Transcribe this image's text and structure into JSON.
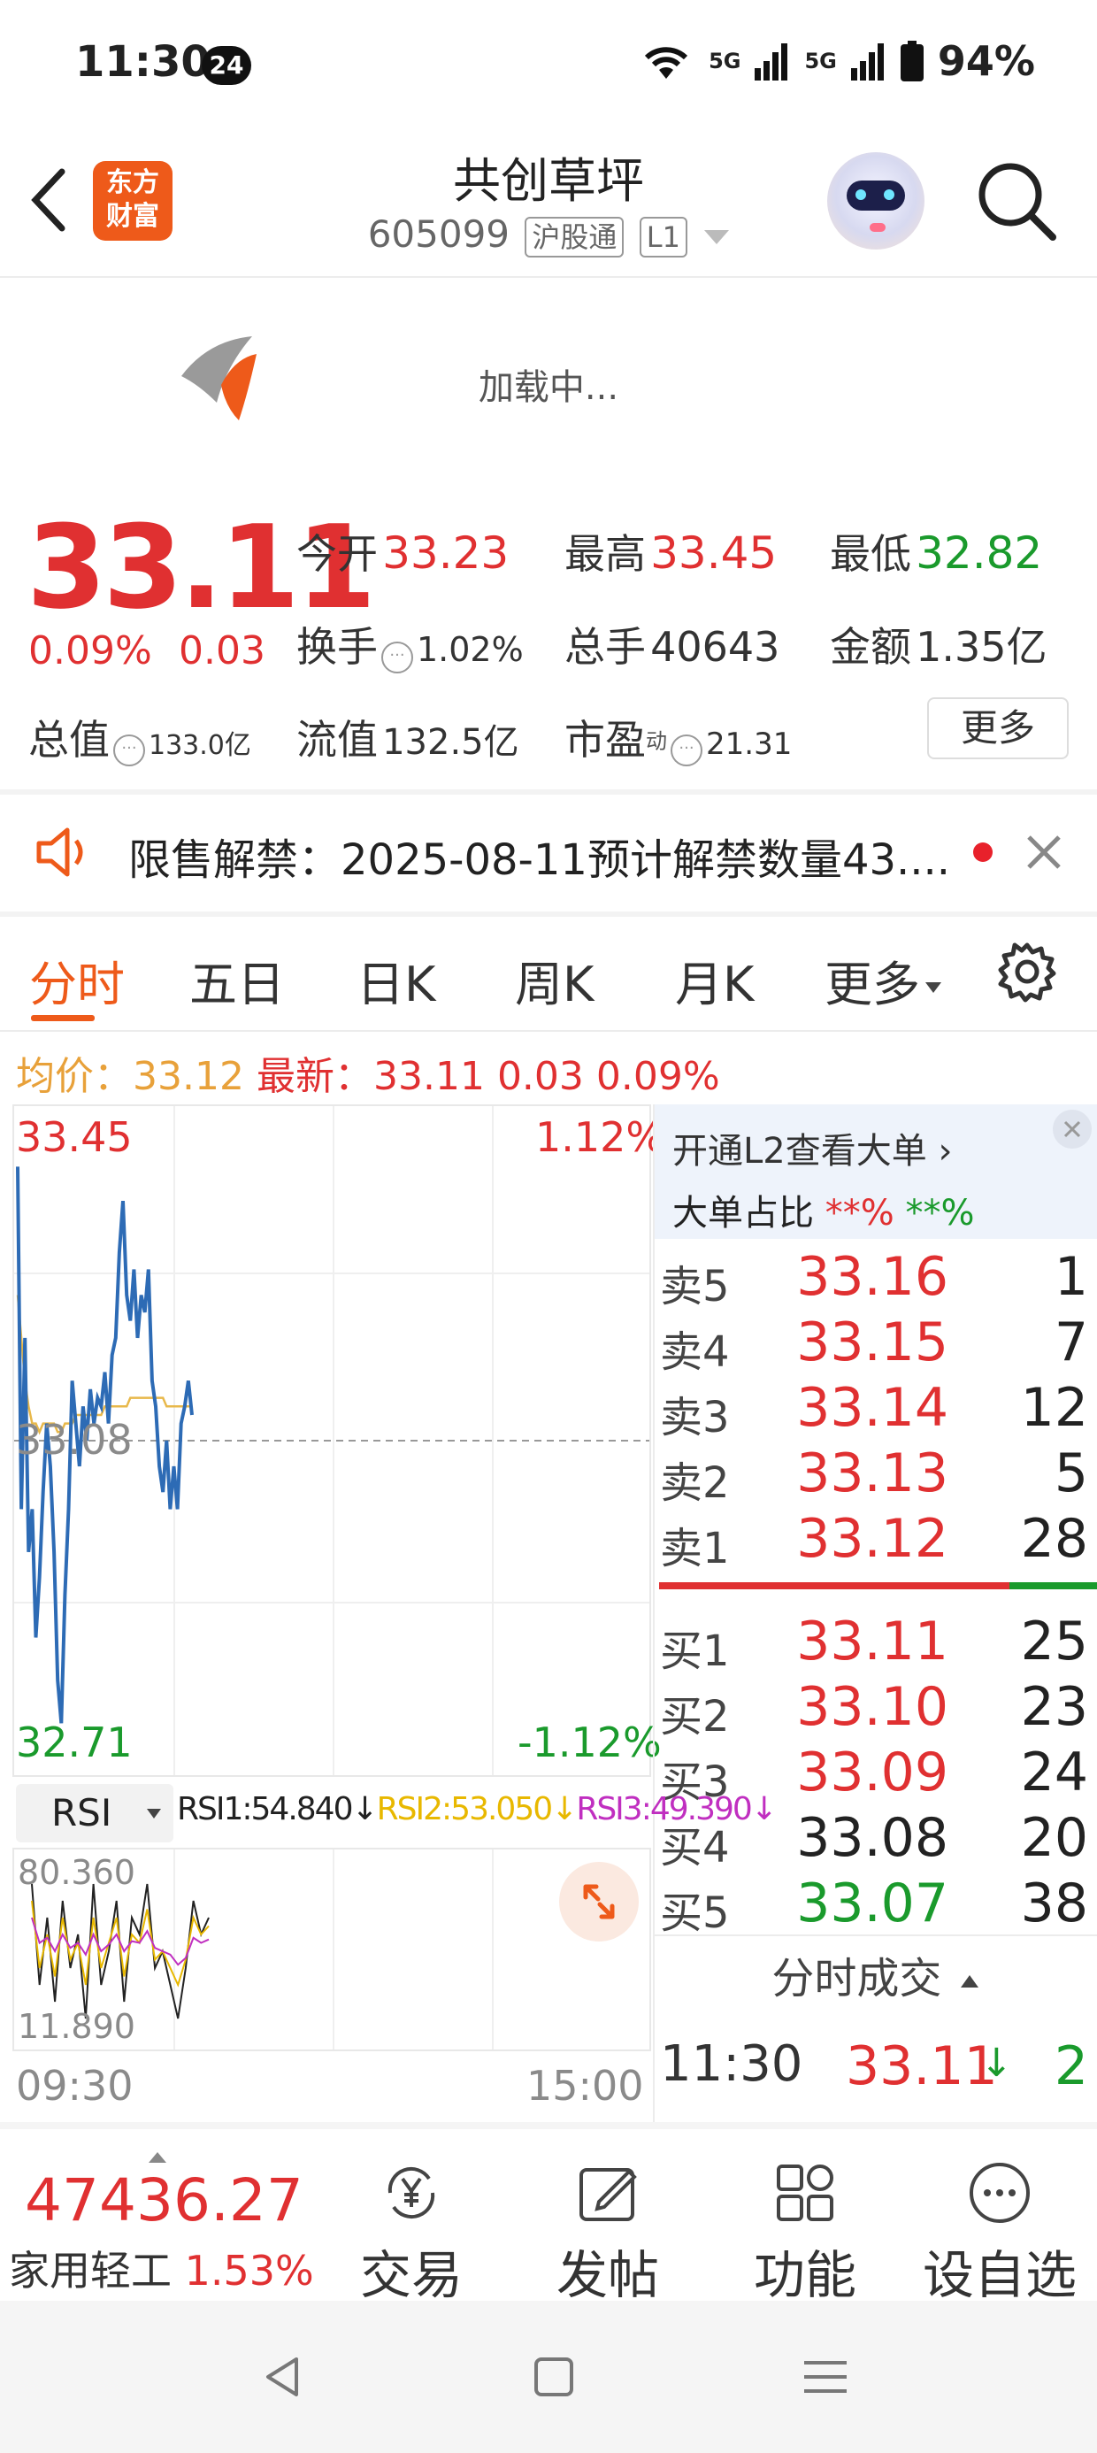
{
  "status_bar": {
    "time": "11:30",
    "badge": "24",
    "signal1": "5G",
    "signal2": "5G",
    "battery": "94%"
  },
  "header": {
    "logo_text": "东方\n财富",
    "title": "共创草坪",
    "code": "605099",
    "tag_market": "沪股通",
    "tag_level": "L1"
  },
  "ad": {
    "loading_text": "加载中..."
  },
  "quote": {
    "price": "33.11",
    "change_pct": "0.09%",
    "change_amt": "0.03",
    "open_label": "今开",
    "open": "33.23",
    "high_label": "最高",
    "high": "33.45",
    "low_label": "最低",
    "low": "32.82",
    "turnover_label": "换手",
    "turnover": "1.02%",
    "volume_label": "总手",
    "volume": "40643",
    "amount_label": "金额",
    "amount": "1.35亿",
    "mcap_label": "总值",
    "mcap": "133.0亿",
    "float_label": "流值",
    "float": "132.5亿",
    "pe_label": "市盈",
    "pe_sup": "动",
    "pe": "21.31",
    "more_button": "更多"
  },
  "notice": {
    "text": "限售解禁：2025-08-11预计解禁数量43...."
  },
  "tabs": [
    "分时",
    "五日",
    "日K",
    "周K",
    "月K",
    "更多"
  ],
  "avg_line": {
    "avg_label": "均价：",
    "avg_value": "33.12",
    "latest_label": "最新：",
    "latest_value": "33.11",
    "change_amt": "0.03",
    "change_pct": "0.09%"
  },
  "chart_data": {
    "type": "line",
    "y_high": "33.45",
    "y_low": "32.71",
    "y_mid": "33.08",
    "pct_high": "1.12%",
    "pct_low": "-1.12%",
    "x_start": "09:30",
    "x_end": "15:00",
    "ylim": [
      32.71,
      33.45
    ],
    "series": [
      {
        "values": [
          33.4,
          33.0,
          33.2,
          32.95,
          33.0,
          32.85,
          32.92,
          33.02,
          33.1,
          33.05,
          32.95,
          32.8,
          32.75,
          32.9,
          33.0,
          33.15,
          33.1,
          33.05,
          33.12,
          33.08,
          33.14,
          33.1,
          33.13,
          33.12,
          33.16,
          33.1,
          33.18,
          33.2,
          33.3,
          33.36,
          33.25,
          33.22,
          33.28,
          33.2,
          33.25,
          33.23,
          33.28,
          33.15,
          33.12,
          33.05,
          33.02,
          33.08,
          33.0,
          33.05,
          33.0,
          33.1,
          33.12,
          33.15,
          33.11
        ]
      },
      {
        "values": [
          33.25,
          33.2,
          33.15,
          33.12,
          33.1,
          33.1,
          33.09,
          33.1,
          33.1,
          33.1,
          33.1,
          33.09,
          33.09,
          33.1,
          33.1,
          33.1,
          33.11,
          33.11,
          33.11,
          33.11,
          33.11,
          33.11,
          33.11,
          33.11,
          33.12,
          33.12,
          33.12,
          33.12,
          33.12,
          33.12,
          33.12,
          33.13,
          33.13,
          33.13,
          33.13,
          33.13,
          33.13,
          33.13,
          33.13,
          33.13,
          33.13,
          33.12,
          33.12,
          33.12,
          33.12,
          33.12,
          33.12,
          33.12,
          33.12
        ]
      }
    ]
  },
  "order_book": {
    "l2_text": "开通L2查看大单 ›",
    "big_order_label": "大单占比",
    "big_order_red": "**%",
    "big_order_green": "**%",
    "asks": [
      {
        "label": "卖5",
        "price": "33.16",
        "vol": "1"
      },
      {
        "label": "卖4",
        "price": "33.15",
        "vol": "7"
      },
      {
        "label": "卖3",
        "price": "33.14",
        "vol": "12"
      },
      {
        "label": "卖2",
        "price": "33.13",
        "vol": "5"
      },
      {
        "label": "卖1",
        "price": "33.12",
        "vol": "28"
      }
    ],
    "bids": [
      {
        "label": "买1",
        "price": "33.11",
        "vol": "25"
      },
      {
        "label": "买2",
        "price": "33.10",
        "vol": "23"
      },
      {
        "label": "买3",
        "price": "33.09",
        "vol": "24"
      },
      {
        "label": "买4",
        "price": "33.08",
        "vol": "20"
      },
      {
        "label": "买5",
        "price": "33.07",
        "vol": "38"
      }
    ],
    "trades_title": "分时成交",
    "trade": {
      "time": "11:30",
      "price": "33.11",
      "vol": "2"
    }
  },
  "rsi": {
    "selector": "RSI",
    "rsi1": "RSI1:54.840↓",
    "rsi2": "RSI2:53.050↓",
    "rsi3": "RSI3:49.390↓",
    "y_high": "80.360",
    "y_low": "11.890"
  },
  "bottom": {
    "index_value": "47436.27",
    "index_name": "家用轻工",
    "index_pct": "1.53%",
    "nav": [
      "交易",
      "发帖",
      "功能",
      "设自选"
    ]
  },
  "colors": {
    "red": "#e03031",
    "green": "#1a9a2c",
    "accent": "#ee5a1a",
    "price_line": "#2d6bb5",
    "avg_line": "#e8b84a"
  }
}
